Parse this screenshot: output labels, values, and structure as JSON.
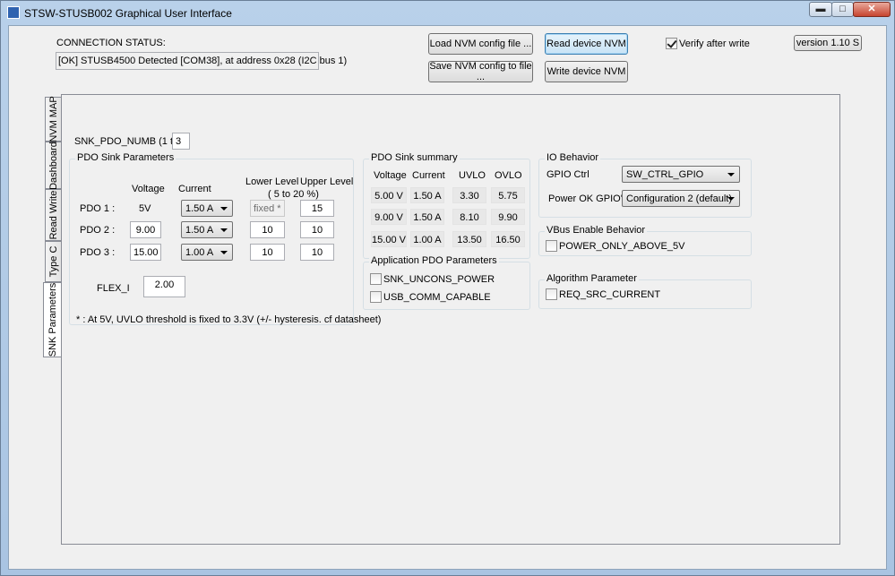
{
  "window": {
    "title": "STSW-STUSB002 Graphical User Interface"
  },
  "connection": {
    "label": "CONNECTION STATUS:",
    "status": "[OK]  STUSB4500 Detected [COM38], at address 0x28 (I2C bus 1)"
  },
  "toolbar": {
    "load_nvm": "Load NVM config file ...",
    "save_nvm": "Save NVM config to file ...",
    "read_nvm": "Read device NVM",
    "write_nvm": "Write device NVM",
    "verify_label": "Verify after write",
    "version": "version 1.10 S"
  },
  "tabs": [
    "NVM MAP",
    "Dashboard",
    "Read Write",
    "Type C",
    "SNK Parameters"
  ],
  "snk": {
    "pdo_numb_label": "SNK_PDO_NUMB (1 to 3)",
    "pdo_numb_value": "3",
    "params_title": "PDO Sink Parameters",
    "headers": {
      "voltage": "Voltage",
      "current": "Current",
      "lower": "Lower Level",
      "upper": "Upper Level",
      "range": "( 5 to 20 %)"
    },
    "rows": [
      {
        "label": "PDO 1 :",
        "voltage": "5V",
        "current": "1.50 A",
        "lower": "fixed *",
        "upper": "15"
      },
      {
        "label": "PDO 2 :",
        "voltage": "9.00",
        "current": "1.50 A",
        "lower": "10",
        "upper": "10"
      },
      {
        "label": "PDO 3 :",
        "voltage": "15.00",
        "current": "1.00 A",
        "lower": "10",
        "upper": "10"
      }
    ],
    "flex_label": "FLEX_I",
    "flex_value": "2.00",
    "footnote": "* : At 5V, UVLO threshold is fixed to 3.3V (+/- hysteresis. cf datasheet)"
  },
  "summary": {
    "title": "PDO Sink summary",
    "headers": [
      "Voltage",
      "Current",
      "UVLO",
      "OVLO"
    ],
    "rows": [
      [
        "5.00 V",
        "1.50 A",
        "3.30",
        "5.75"
      ],
      [
        "9.00 V",
        "1.50 A",
        "8.10",
        "9.90"
      ],
      [
        "15.00 V",
        "1.00 A",
        "13.50",
        "16.50"
      ]
    ]
  },
  "app_pdo": {
    "title": "Application PDO Parameters",
    "snk_uncons": "SNK_UNCONS_POWER",
    "usb_comm": "USB_COMM_CAPABLE"
  },
  "io": {
    "title": "IO Behavior",
    "gpio_label": "GPIO Ctrl",
    "gpio_value": "SW_CTRL_GPIO",
    "power_ok_label": "Power OK GPIO's",
    "power_ok_value": "Configuration 2 (default)"
  },
  "vbus": {
    "title": "VBus Enable Behavior",
    "option": "POWER_ONLY_ABOVE_5V"
  },
  "algo": {
    "title": "Algorithm Parameter",
    "option": "REQ_SRC_CURRENT"
  }
}
